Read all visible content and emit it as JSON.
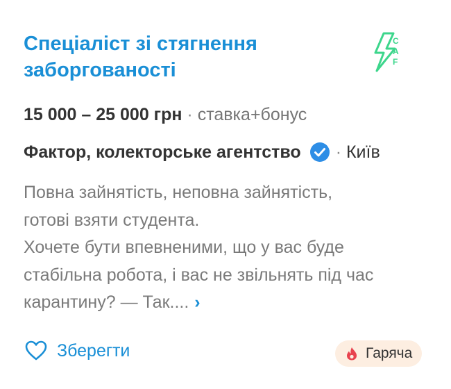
{
  "vacancy": {
    "title": "Спеціаліст зі стягнення заборгованості",
    "salary": "15 000 – 25 000 грн",
    "separator": "·",
    "salary_note": "ставка+бонус",
    "company": "Фактор, колекторське агентство",
    "city": "Київ",
    "description_lines": [
      "Повна зайнятість, неповна зайнятість,",
      "готові взяти студента.",
      "Хочете бути впевненими, що у вас буде",
      "стабільна робота, і вас не звільнять під час",
      "карантину? — Так...."
    ],
    "more_glyph": "›"
  },
  "logo": {
    "letters": [
      "C",
      "A",
      "F"
    ],
    "color": "#3dd68c"
  },
  "actions": {
    "save_label": "Зберегти",
    "hot_label": "Гаряча"
  },
  "colors": {
    "accent": "#1a8fd6",
    "hot_bg": "#fdeee1",
    "hot_icon": "#e8424e",
    "verified": "#2e8ee6"
  }
}
